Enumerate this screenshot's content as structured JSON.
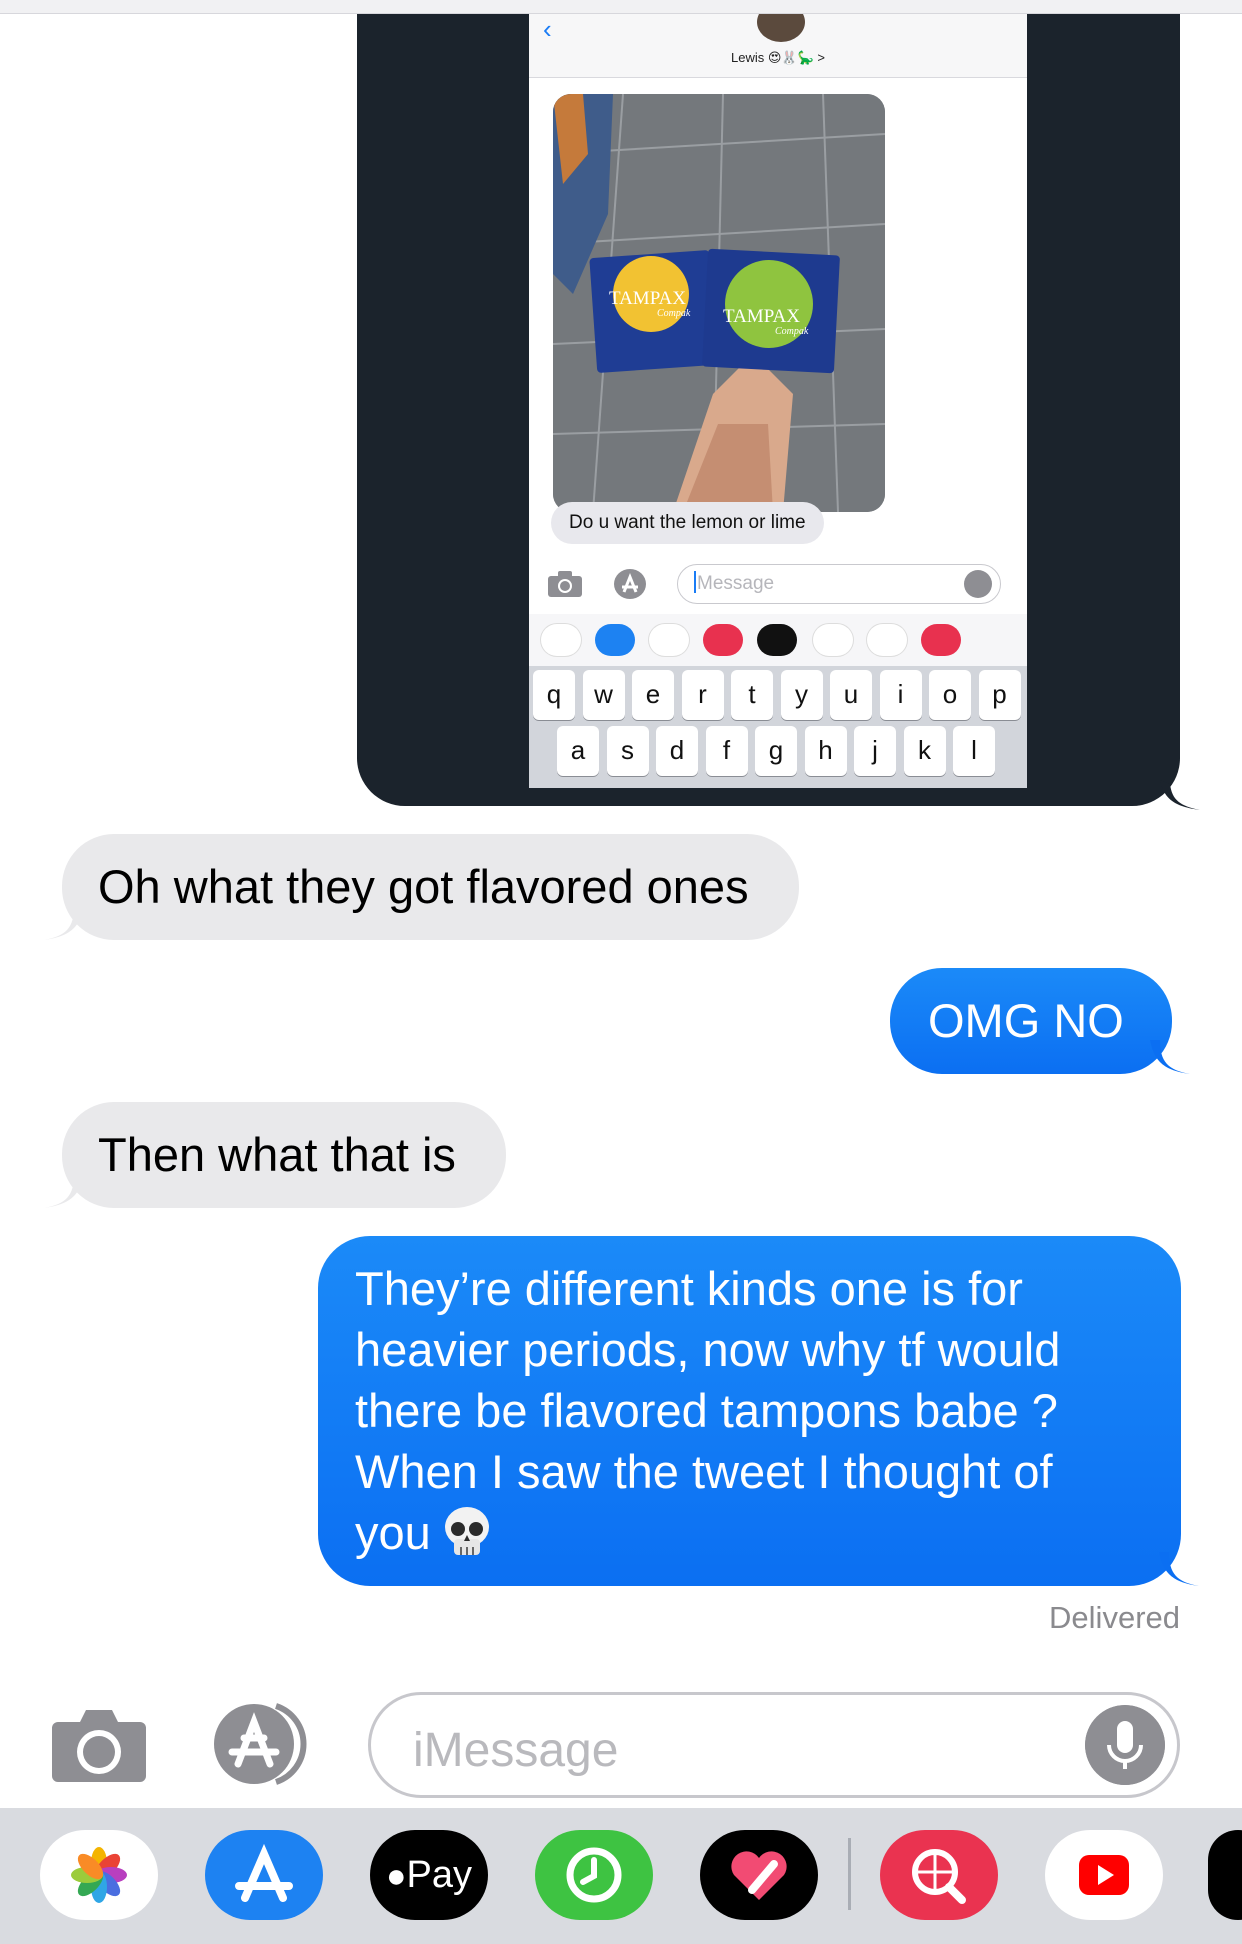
{
  "embedded_screenshot": {
    "contact_name": "Lewis 😍🐰🦕 >",
    "box_brand_1": "TAMPAX",
    "box_sub_1": "Compak",
    "box_brand_2": "TAMPAX",
    "box_sub_2": "Compak",
    "message": "Do u want the lemon or lime",
    "input_placeholder": "Message",
    "keyboard_row1": [
      "q",
      "w",
      "e",
      "r",
      "t",
      "y",
      "u",
      "i",
      "o",
      "p"
    ],
    "keyboard_row2": [
      "a",
      "s",
      "d",
      "f",
      "g",
      "h",
      "j",
      "k",
      "l"
    ]
  },
  "messages": [
    {
      "direction": "received",
      "text": "Oh what they got flavored ones"
    },
    {
      "direction": "sent",
      "text": "OMG NO"
    },
    {
      "direction": "received",
      "text": "Then what that is"
    },
    {
      "direction": "sent",
      "lines": [
        "They’re different kinds one is for",
        "heavier periods, now why tf would",
        "there be flavored tampons babe ?",
        "When I saw the tweet I thought of",
        "you"
      ],
      "emoji": "skull"
    }
  ],
  "status": "Delivered",
  "composer": {
    "placeholder": "iMessage"
  },
  "app_drawer": {
    "items": [
      "photos-icon",
      "app-store-icon",
      "apple-pay-icon",
      "activity-icon",
      "digital-touch-icon",
      "search-images-icon",
      "youtube-icon",
      "partial-app-icon"
    ],
    "apple_pay_label": "Pay"
  },
  "colors": {
    "sent_bubble": "#0b7af5",
    "received_bubble": "#e9e9eb",
    "accent": "#1a7cf5"
  }
}
